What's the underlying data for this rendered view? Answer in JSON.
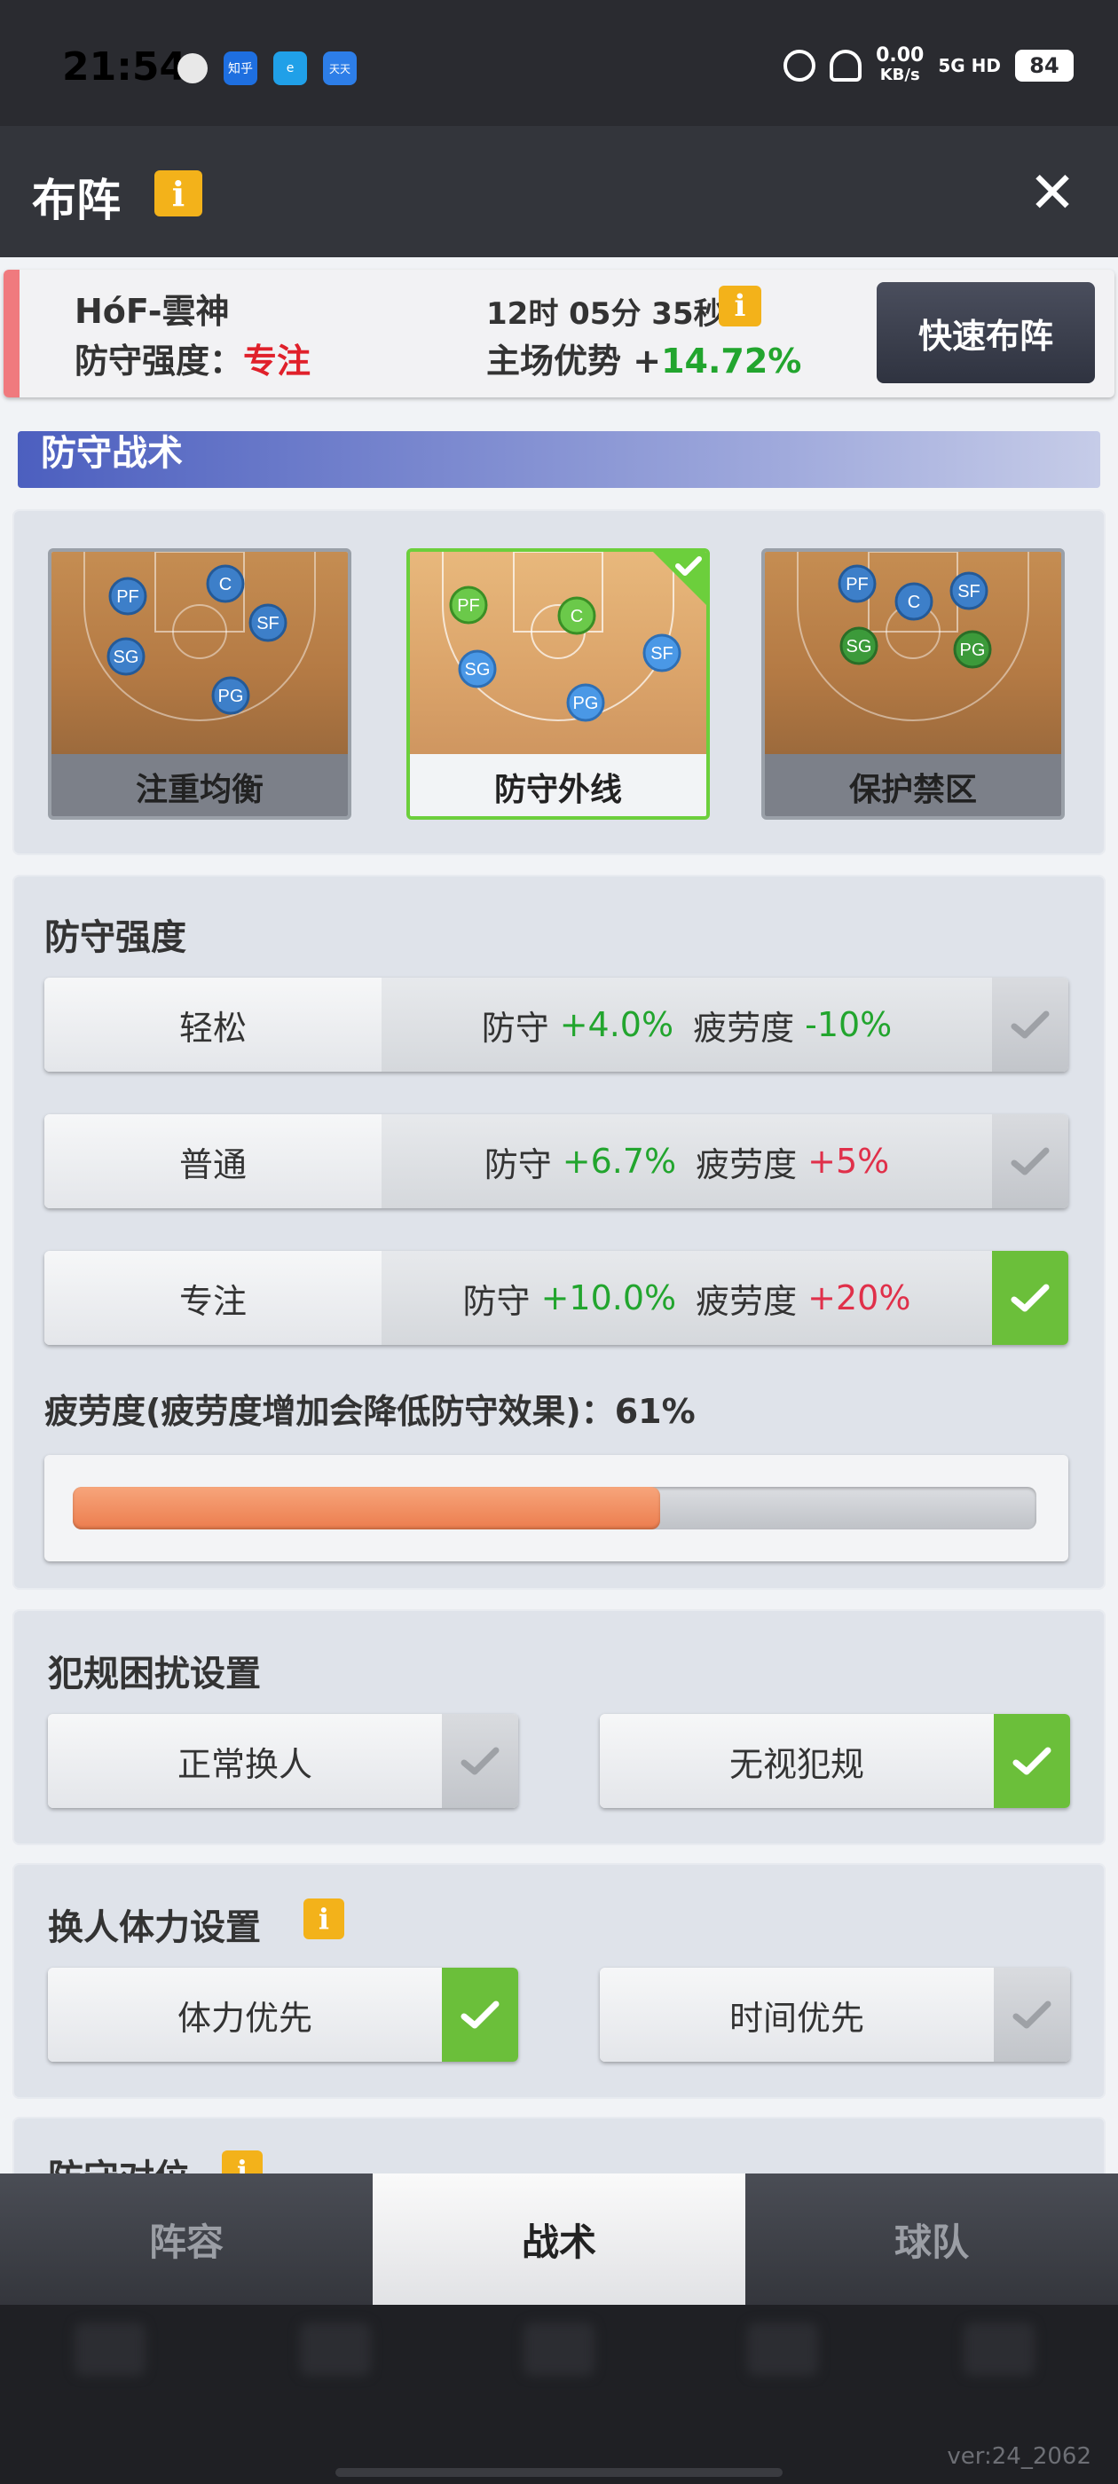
{
  "status_bar": {
    "time": "21:54",
    "app_icons": [
      "知乎",
      "e",
      "天天"
    ],
    "net_speed_value": "0.00",
    "net_speed_unit": "KB/s",
    "signal": "5G HD",
    "battery": "84"
  },
  "header": {
    "title": "布阵",
    "info_icon": "i",
    "close_icon": "✕"
  },
  "team": {
    "name": "HóF-雲神",
    "intensity_label": "防守强度：",
    "intensity_value": "专注",
    "timer": "12时 05分 35秒",
    "timer_info": "i",
    "home_label": "主场优势 +",
    "home_value": "14.72%",
    "quick_button": "快速布阵"
  },
  "defense_tactics": {
    "section_title": "防守战术",
    "options": [
      {
        "label": "注重均衡",
        "selected": false,
        "positions": [
          "PF",
          "C",
          "SF",
          "SG",
          "PG"
        ]
      },
      {
        "label": "防守外线",
        "selected": true,
        "positions": [
          "PF",
          "C",
          "SG",
          "SF",
          "PG"
        ]
      },
      {
        "label": "保护禁区",
        "selected": false,
        "positions": [
          "PF",
          "C",
          "SF",
          "SG",
          "PG"
        ]
      }
    ]
  },
  "defense_intensity": {
    "title": "防守强度",
    "options": [
      {
        "label": "轻松",
        "def_label": "防守",
        "def_value": "+4.0%",
        "fat_label": "疲劳度",
        "fat_value": "-10%",
        "selected": false
      },
      {
        "label": "普通",
        "def_label": "防守",
        "def_value": "+6.7%",
        "fat_label": "疲劳度",
        "fat_value": "+5%",
        "selected": false
      },
      {
        "label": "专注",
        "def_label": "防守",
        "def_value": "+10.0%",
        "fat_label": "疲劳度",
        "fat_value": "+20%",
        "selected": true
      }
    ],
    "fatigue_label": "疲劳度(疲劳度增加会降低防守效果)：61%",
    "fatigue_percent": 61
  },
  "foul_settings": {
    "title": "犯规困扰设置",
    "options": [
      {
        "label": "正常换人",
        "selected": false
      },
      {
        "label": "无视犯规",
        "selected": true
      }
    ]
  },
  "sub_settings": {
    "title": "换人体力设置",
    "info_icon": "i",
    "options": [
      {
        "label": "体力优先",
        "selected": true
      },
      {
        "label": "时间优先",
        "selected": false
      }
    ]
  },
  "next_section": {
    "title": "防守对位",
    "info_icon": "i"
  },
  "bottom_tabs": [
    {
      "label": "阵容",
      "active": false
    },
    {
      "label": "战术",
      "active": true
    },
    {
      "label": "球队",
      "active": false
    }
  ],
  "version": "ver:24_2062",
  "colors": {
    "green": "#22a52e",
    "red": "#e0304a",
    "check_green": "#6bbf3a",
    "info_yellow": "#f3b21a",
    "banner_blue": "#4c5fbf",
    "fatigue_orange": "#ec7d4e"
  }
}
